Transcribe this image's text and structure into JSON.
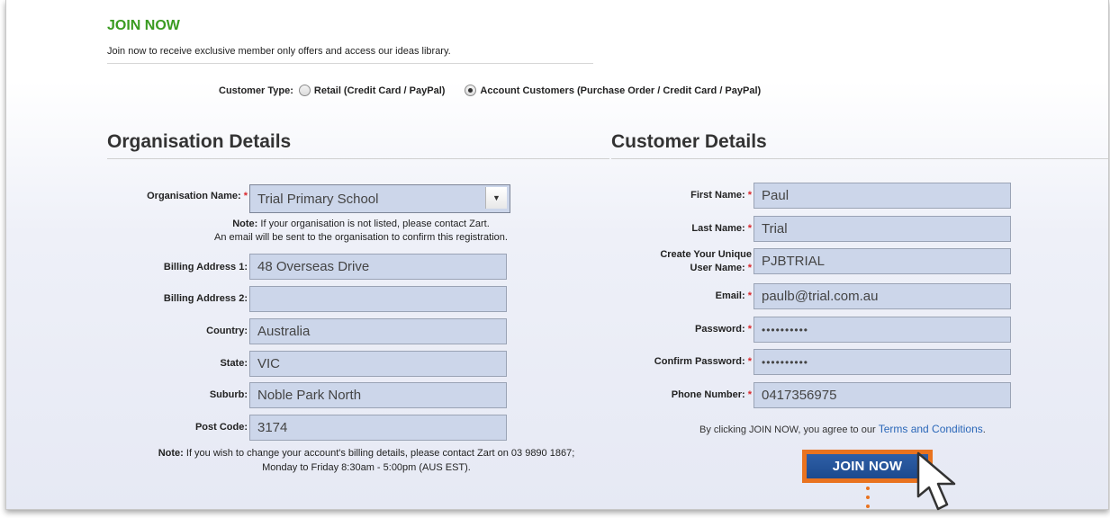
{
  "header": {
    "title": "JOIN NOW",
    "intro": "Join now to receive exclusive member only offers and access our ideas library."
  },
  "customer_type": {
    "label": "Customer Type:",
    "options": [
      {
        "label": "Retail (Credit Card / PayPal)",
        "selected": false
      },
      {
        "label": "Account Customers (Purchase Order / Credit Card / PayPal)",
        "selected": true
      }
    ]
  },
  "organisation": {
    "title": "Organisation Details",
    "name_label": "Organisation Name:",
    "name_value": "Trial Primary School",
    "note_bold": "Note:",
    "note_line1": " If your organisation is not listed, please contact Zart.",
    "note_line2": "An email will be sent to the organisation to confirm this registration.",
    "fields": [
      {
        "label": "Billing Address 1:",
        "value": "48 Overseas Drive"
      },
      {
        "label": "Billing Address 2:",
        "value": ""
      },
      {
        "label": "Country:",
        "value": "Australia"
      },
      {
        "label": "State:",
        "value": "VIC"
      },
      {
        "label": "Suburb:",
        "value": "Noble Park North"
      },
      {
        "label": "Post Code:",
        "value": "3174"
      }
    ],
    "footer_note_bold": "Note:",
    "footer_note_line1": " If you wish to change your account's billing details, please contact Zart on 03 9890 1867;",
    "footer_note_line2": "Monday to Friday 8:30am - 5:00pm (AUS EST)."
  },
  "customer": {
    "title": "Customer Details",
    "fields": [
      {
        "label": "First Name:",
        "value": "Paul"
      },
      {
        "label": "Last Name:",
        "value": "Trial"
      },
      {
        "label_line1": "Create Your Unique",
        "label_line2": "User Name:",
        "value": "PJBTRIAL"
      },
      {
        "label": "Email:",
        "value": "paulb@trial.com.au"
      },
      {
        "label": "Password:",
        "value": "••••••••••"
      },
      {
        "label": "Confirm Password:",
        "value": "••••••••••"
      },
      {
        "label": "Phone Number:",
        "value": "0417356975"
      }
    ],
    "terms_text": "By clicking JOIN NOW, you agree to our ",
    "terms_link": "Terms and Conditions",
    "terms_end": ".",
    "submit_label": "JOIN NOW"
  },
  "required_mark": "*",
  "icons": {
    "select": "chevron-down-icon",
    "cursor": "pointer-cursor-icon"
  },
  "colors": {
    "accent_green": "#3a9b21",
    "button_blue": "#1c4a8e",
    "highlight_orange": "#e9731f",
    "field_bg": "#ccd6ea",
    "required_red": "#d9262b"
  }
}
